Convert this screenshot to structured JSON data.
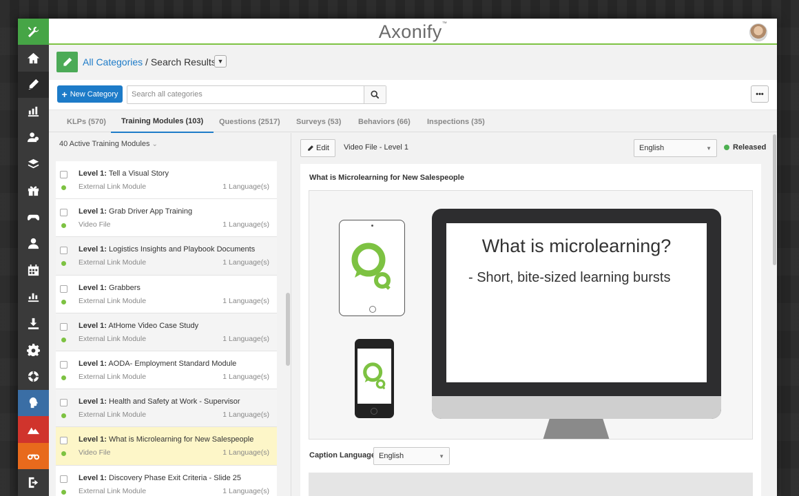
{
  "app": {
    "logo": "Axonify",
    "logo_tm": "™"
  },
  "sidebar": {
    "items": [
      {
        "icon": "tools-icon"
      },
      {
        "icon": "home-icon"
      },
      {
        "icon": "pencil-icon"
      },
      {
        "icon": "reports-icon"
      },
      {
        "icon": "users-group-icon"
      },
      {
        "icon": "layers-icon"
      },
      {
        "icon": "gift-icon"
      },
      {
        "icon": "gamepad-icon"
      },
      {
        "icon": "user-icon"
      },
      {
        "icon": "calendar-icon"
      },
      {
        "icon": "bar-chart-icon"
      },
      {
        "icon": "download-icon"
      },
      {
        "icon": "settings-icon"
      },
      {
        "icon": "lifebuoy-icon"
      },
      {
        "icon": "brain-icon"
      },
      {
        "icon": "mountain-icon"
      },
      {
        "icon": "binoculars-icon"
      },
      {
        "icon": "logout-icon"
      }
    ]
  },
  "breadcrumb": {
    "link": "All Categories",
    "separator": " / ",
    "current": "Search Results"
  },
  "toolbar": {
    "new_category_label": "New Category",
    "search_placeholder": "Search all categories",
    "more_label": "•••"
  },
  "tabs": [
    {
      "label": "KLPs (570)"
    },
    {
      "label": "Training Modules (103)"
    },
    {
      "label": "Questions (2517)"
    },
    {
      "label": "Surveys (53)"
    },
    {
      "label": "Behaviors (66)"
    },
    {
      "label": "Inspections (35)"
    }
  ],
  "list": {
    "header": "40 Active Training Modules",
    "items": [
      {
        "level": "Level 1:",
        "name": "Tell a Visual Story",
        "type": "External Link Module",
        "languages": "1 Language(s)"
      },
      {
        "level": "Level 1:",
        "name": "Grab Driver App Training",
        "type": "Video File",
        "languages": "1 Language(s)"
      },
      {
        "level": "Level 1:",
        "name": "Logistics Insights and Playbook Documents",
        "type": "External Link Module",
        "languages": "1 Language(s)"
      },
      {
        "level": "Level 1:",
        "name": "Grabbers",
        "type": "External Link Module",
        "languages": "1 Language(s)"
      },
      {
        "level": "Level 1:",
        "name": "AtHome Video Case Study",
        "type": "External Link Module",
        "languages": "1 Language(s)"
      },
      {
        "level": "Level 1:",
        "name": "AODA- Employment Standard Module",
        "type": "External Link Module",
        "languages": "1 Language(s)"
      },
      {
        "level": "Level 1:",
        "name": "Health and Safety at Work - Supervisor",
        "type": "External Link Module",
        "languages": "1 Language(s)"
      },
      {
        "level": "Level 1:",
        "name": "What is Microlearning for New Salespeople",
        "type": "Video File",
        "languages": "1 Language(s)"
      },
      {
        "level": "Level 1:",
        "name": "Discovery Phase Exit Criteria - Slide 25",
        "type": "External Link Module",
        "languages": "1 Language(s)"
      }
    ]
  },
  "detail": {
    "edit_label": "Edit",
    "file_title": "Video File - Level 1",
    "language": "English",
    "status": "Released",
    "content_title": "What is Microlearning for New Salespeople",
    "slide_title": "What is microlearning?",
    "slide_bullet": "- Short, bite-sized learning bursts",
    "caption_label": "Caption Language",
    "caption_language": "English"
  },
  "colors": {
    "brand_green": "#7dc242",
    "link_blue": "#1d7bc8",
    "selected_row": "#fdf6c8"
  }
}
